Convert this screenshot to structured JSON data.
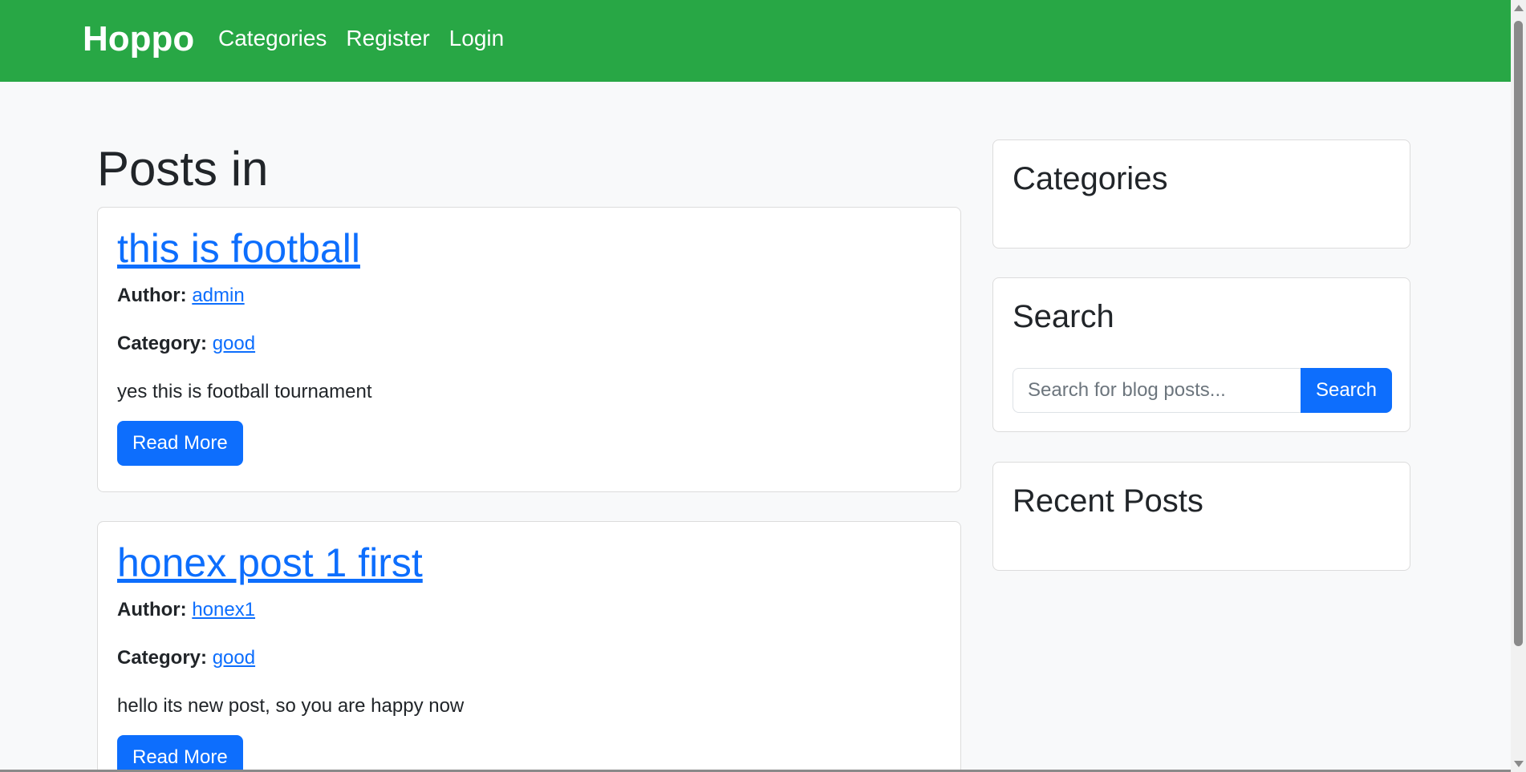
{
  "navbar": {
    "brand": "Hoppo",
    "links": [
      "Categories",
      "Register",
      "Login"
    ],
    "color": "#28a745"
  },
  "main": {
    "heading": "Posts in",
    "posts": [
      {
        "title": "this is football",
        "author_label": "Author:",
        "author": "admin",
        "category_label": "Category:",
        "category": "good",
        "excerpt": "yes this is football tournament",
        "button": "Read More"
      },
      {
        "title": "honex post 1 first",
        "author_label": "Author:",
        "author": "honex1",
        "category_label": "Category:",
        "category": "good",
        "excerpt": "hello its new post, so you are happy now",
        "button": "Read More"
      }
    ]
  },
  "sidebar": {
    "categories_title": "Categories",
    "search_title": "Search",
    "search_placeholder": "Search for blog posts...",
    "search_button": "Search",
    "recent_title": "Recent Posts"
  },
  "colors": {
    "link": "#0d6efd",
    "button": "#0d6efd",
    "background": "#f8f9fa"
  }
}
